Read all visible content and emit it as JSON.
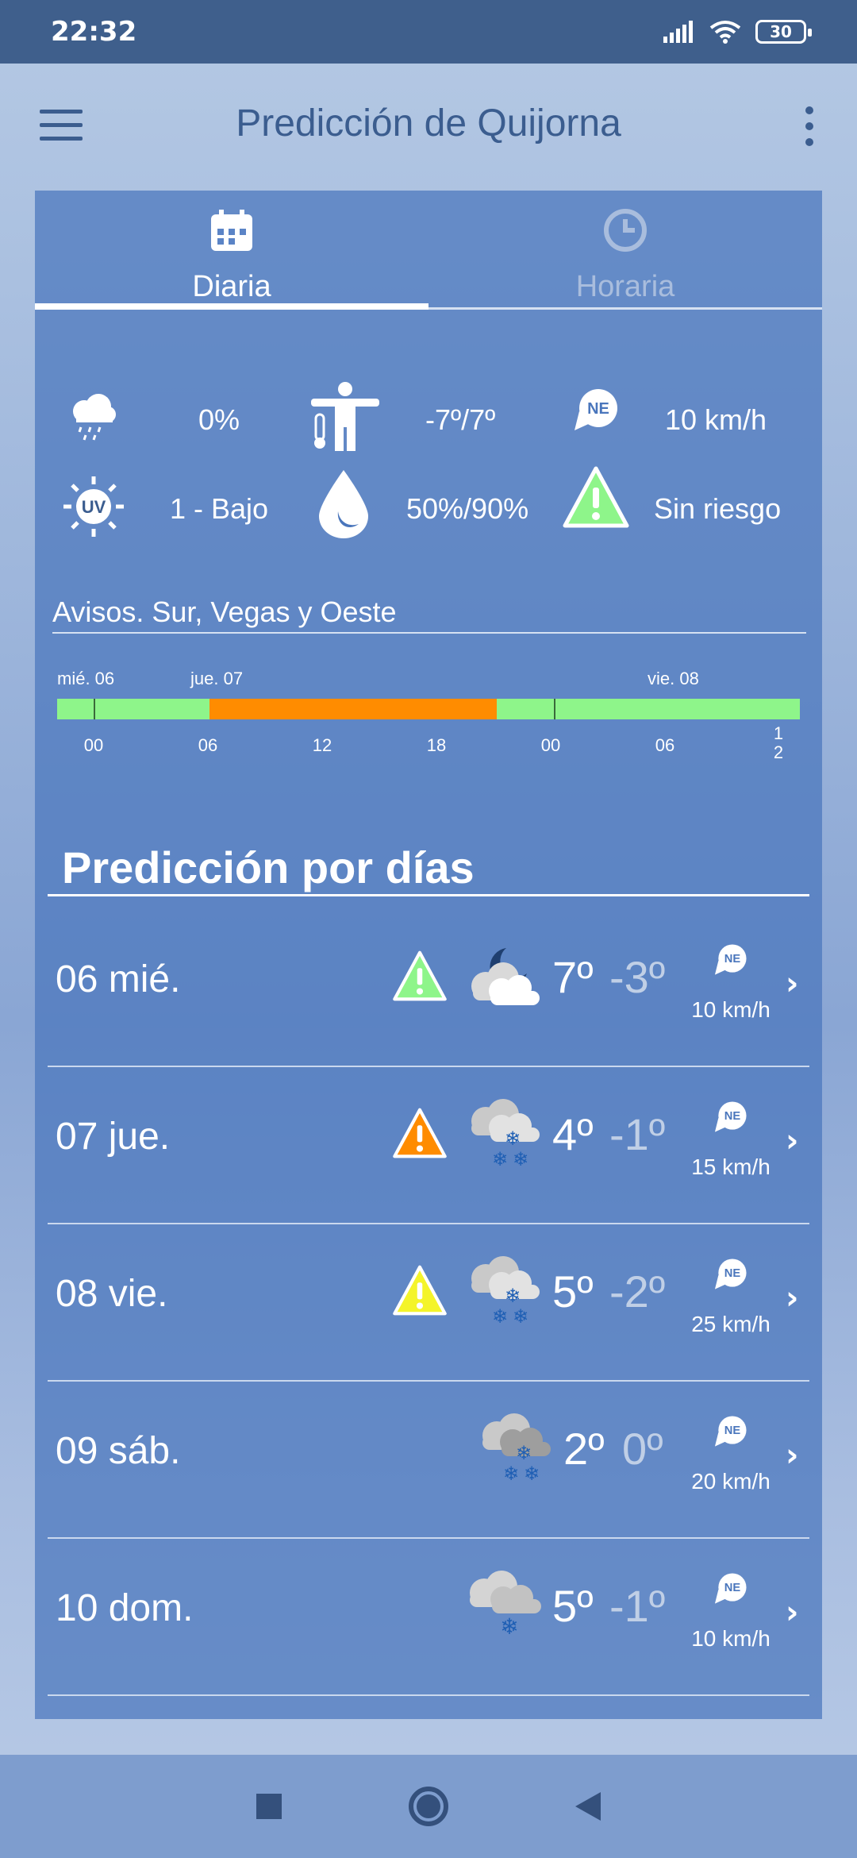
{
  "status": {
    "time": "22:32",
    "battery": "30"
  },
  "appbar": {
    "title": "Predicción de Quijorna"
  },
  "tabs": [
    {
      "label": "Diaria"
    },
    {
      "label": "Horaria"
    }
  ],
  "summary": {
    "rain_prob": "0%",
    "temp_range": "-7º/7º",
    "wind_dir": "NE",
    "wind_speed": "10 km/h",
    "uv": "1 - Bajo",
    "uv_icon_text": "UV",
    "humidity": "50%/90%",
    "risk": "Sin riesgo"
  },
  "avisos": {
    "title": "Avisos. Sur, Vegas y Oeste",
    "dates": [
      "mié. 06",
      "jue. 07",
      "vie. 08"
    ],
    "hours": [
      "00",
      "06",
      "12",
      "18",
      "00",
      "06",
      "1\n2"
    ],
    "colors": {
      "none": "#8ef58a",
      "orange": "#ff8c00"
    }
  },
  "forecast": {
    "title": "Predicción por días",
    "days": [
      {
        "label": "06 mié.",
        "warning": "green",
        "icon": "cloud-moon-icon",
        "max": "7º",
        "min": "-3º",
        "wind_dir": "NE",
        "wind": "10 km/h"
      },
      {
        "label": "07 jue.",
        "warning": "orange",
        "icon": "snow-cloud-icon",
        "max": "4º",
        "min": "-1º",
        "wind_dir": "NE",
        "wind": "15 km/h"
      },
      {
        "label": "08 vie.",
        "warning": "yellow",
        "icon": "snow-cloud-icon",
        "max": "5º",
        "min": "-2º",
        "wind_dir": "NE",
        "wind": "25 km/h"
      },
      {
        "label": "09 sáb.",
        "warning": "",
        "icon": "snow-cloud-icon",
        "max": "2º",
        "min": "0º",
        "wind_dir": "NE",
        "wind": "20 km/h"
      },
      {
        "label": "10 dom.",
        "warning": "",
        "icon": "light-snow-cloud-icon",
        "max": "5º",
        "min": "-1º",
        "wind_dir": "NE",
        "wind": "10 km/h"
      }
    ]
  }
}
